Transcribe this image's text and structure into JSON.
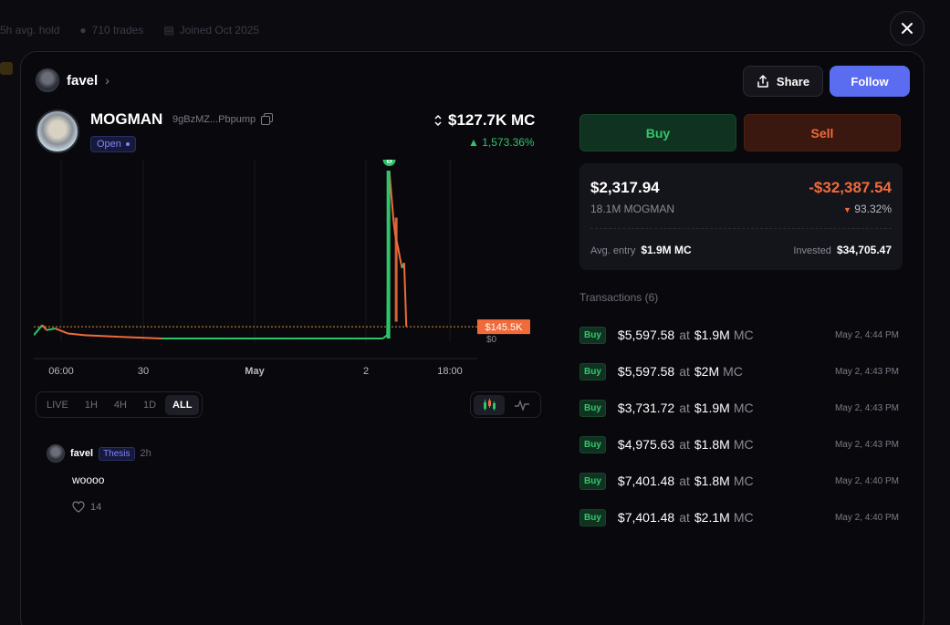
{
  "background": {
    "avg_hold": "5h avg. hold",
    "trades": "710 trades",
    "joined": "Joined Oct 2025"
  },
  "user": {
    "name": "favel"
  },
  "actions": {
    "share": "Share",
    "follow": "Follow"
  },
  "token": {
    "name": "MOGMAN",
    "address": "9gBzMZ...Pbpump",
    "status": "Open",
    "market_cap": "$127.7K MC",
    "change": "1,573.36%"
  },
  "chart_data": {
    "type": "line",
    "x_ticks": [
      "06:00",
      "30",
      "May",
      "2",
      "18:00"
    ],
    "y_label_low": "$0",
    "current_price_label": "$145.5K",
    "marker": "B",
    "colors": {
      "up": "#2ec46a",
      "down": "#f06a3a",
      "ref": "#e08a30"
    },
    "points": [
      [
        0.0,
        0.02
      ],
      [
        0.01,
        0.05
      ],
      [
        0.02,
        0.08
      ],
      [
        0.03,
        0.05
      ],
      [
        0.05,
        0.06
      ],
      [
        0.08,
        0.03
      ],
      [
        0.12,
        0.02
      ],
      [
        0.2,
        0.01
      ],
      [
        0.3,
        0.0
      ],
      [
        0.45,
        0.0
      ],
      [
        0.6,
        0.0
      ],
      [
        0.75,
        0.0
      ],
      [
        0.82,
        0.0
      ],
      [
        0.83,
        0.02
      ],
      [
        0.835,
        1.0
      ],
      [
        0.84,
        0.85
      ],
      [
        0.845,
        0.7
      ],
      [
        0.85,
        0.6
      ],
      [
        0.855,
        0.55
      ],
      [
        0.86,
        0.48
      ],
      [
        0.865,
        0.42
      ],
      [
        0.87,
        0.45
      ],
      [
        0.875,
        0.07
      ]
    ]
  },
  "timeframes": [
    "LIVE",
    "1H",
    "4H",
    "1D",
    "ALL"
  ],
  "active_timeframe": "ALL",
  "comment": {
    "user": "favel",
    "badge": "Thesis",
    "time": "2h",
    "text": "woooo",
    "likes": "14"
  },
  "trade": {
    "buy": "Buy",
    "sell": "Sell"
  },
  "position": {
    "value": "$2,317.94",
    "amount": "18.1M MOGMAN",
    "pnl": "-$32,387.54",
    "pnl_pct": "93.32%",
    "avg_entry_label": "Avg. entry",
    "avg_entry": "$1.9M MC",
    "invested_label": "Invested",
    "invested": "$34,705.47"
  },
  "transactions_title": "Transactions (6)",
  "transactions": [
    {
      "type": "Buy",
      "amount": "$5,597.58",
      "mc": "$1.9M",
      "time": "May 2, 4:44 PM"
    },
    {
      "type": "Buy",
      "amount": "$5,597.58",
      "mc": "$2M",
      "time": "May 2, 4:43 PM"
    },
    {
      "type": "Buy",
      "amount": "$3,731.72",
      "mc": "$1.9M",
      "time": "May 2, 4:43 PM"
    },
    {
      "type": "Buy",
      "amount": "$4,975.63",
      "mc": "$1.8M",
      "time": "May 2, 4:43 PM"
    },
    {
      "type": "Buy",
      "amount": "$7,401.48",
      "mc": "$1.8M",
      "time": "May 2, 4:40 PM"
    },
    {
      "type": "Buy",
      "amount": "$7,401.48",
      "mc": "$2.1M",
      "time": "May 2, 4:40 PM"
    }
  ],
  "labels": {
    "at": "at",
    "mc_suffix": "MC"
  }
}
